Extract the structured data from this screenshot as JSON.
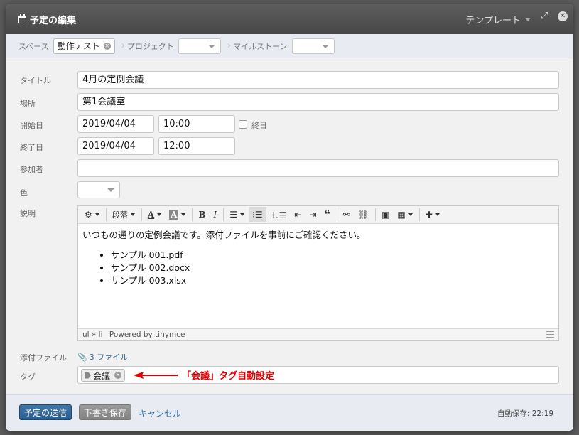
{
  "dialog": {
    "title": "予定の編集",
    "template_menu": "テンプレート"
  },
  "scope": {
    "space_label": "スペース",
    "space_value": "動作テスト",
    "project_label": "プロジェクト",
    "milestone_label": "マイルストーン"
  },
  "form": {
    "title_label": "タイトル",
    "title_value": "4月の定例会議",
    "place_label": "場所",
    "place_value": "第1会議室",
    "start_label": "開始日",
    "start_date": "2019/04/04",
    "start_time": "10:00",
    "allday_label": "終日",
    "end_label": "終了日",
    "end_date": "2019/04/04",
    "end_time": "12:00",
    "attendees_label": "参加者",
    "attendees_value": "",
    "color_label": "色",
    "desc_label": "説明",
    "attach_label": "添付ファイル",
    "attach_link": "3 ファイル",
    "tag_label": "タグ",
    "tag_value": "会議"
  },
  "editor": {
    "format_label": "段落",
    "bold": "B",
    "italic": "I",
    "intro": "いつもの通りの定例会議です。添付ファイルを事前にご確認ください。",
    "items": [
      "サンプル 001.pdf",
      "サンプル 002.docx",
      "サンプル 003.xlsx"
    ],
    "path": "ul » li",
    "powered": "Powered by tinymce"
  },
  "annotation": {
    "text": "「会議」タグ自動設定",
    "color": "#e00000"
  },
  "footer": {
    "send_button": "予定の送信",
    "draft_button": "下書き保存",
    "cancel_link": "キャンセル",
    "autosave": "自動保存: 22:19"
  }
}
